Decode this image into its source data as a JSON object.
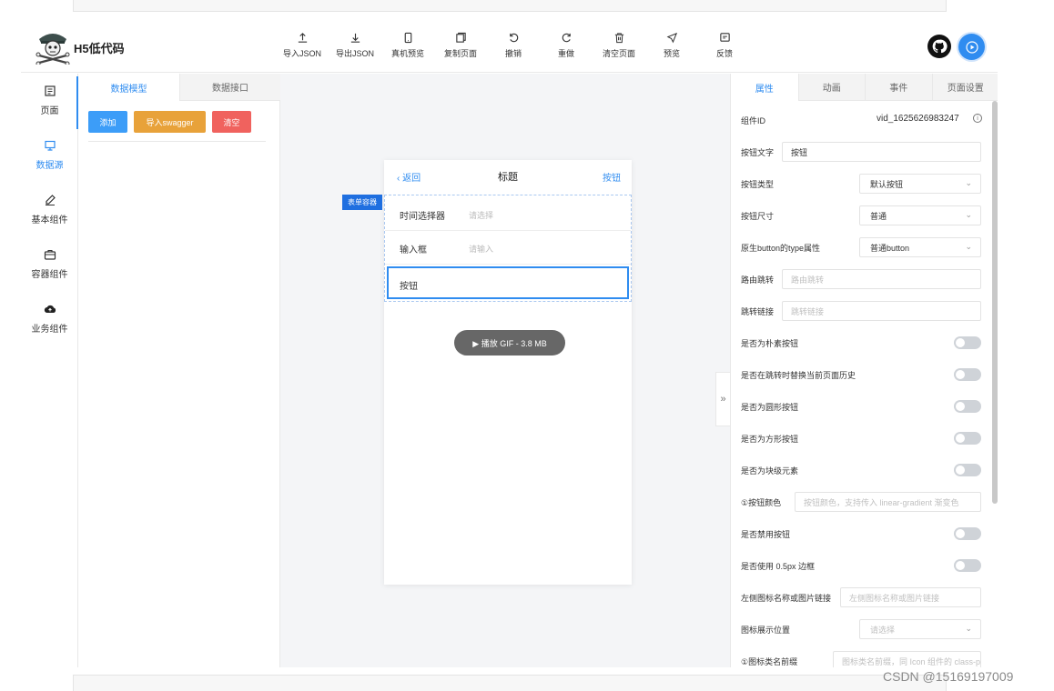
{
  "app": {
    "brand": "H5低代码",
    "toolbar": [
      {
        "label": "导入JSON",
        "icon": "upload-icon"
      },
      {
        "label": "导出JSON",
        "icon": "download-icon"
      },
      {
        "label": "真机预览",
        "icon": "phone-icon"
      },
      {
        "label": "复制页面",
        "icon": "copy-icon"
      },
      {
        "label": "撤销",
        "icon": "undo-icon"
      },
      {
        "label": "重做",
        "icon": "redo-icon"
      },
      {
        "label": "清空页面",
        "icon": "trash-icon"
      },
      {
        "label": "预览",
        "icon": "send-icon"
      },
      {
        "label": "反馈",
        "icon": "feedback-icon"
      }
    ]
  },
  "sidebar": {
    "items": [
      {
        "label": "页面",
        "icon": "page-icon"
      },
      {
        "label": "数据源",
        "icon": "monitor-icon"
      },
      {
        "label": "基本组件",
        "icon": "pen-icon"
      },
      {
        "label": "容器组件",
        "icon": "container-icon"
      },
      {
        "label": "业务组件",
        "icon": "cloud-icon"
      }
    ],
    "active": "数据源"
  },
  "data_panel": {
    "tabs": [
      "数据模型",
      "数据接口"
    ],
    "buttons": {
      "add": "添加",
      "swagger": "导入swagger",
      "clear": "清空"
    }
  },
  "canvas": {
    "nav": {
      "back": "返回",
      "title": "标题",
      "right": "按钮"
    },
    "form_tag": "表单容器",
    "fields": [
      {
        "label": "时间选择器",
        "placeholder": "请选择"
      },
      {
        "label": "输入框",
        "placeholder": "请输入"
      }
    ],
    "selected_button": "按钮",
    "gif_pill": "▶ 播放 GIF - 3.8 MB"
  },
  "props": {
    "tabs": [
      "属性",
      "动画",
      "事件",
      "页面设置"
    ],
    "component_id_label": "组件ID",
    "component_id": "vid_1625626983247",
    "button_text_label": "按钮文字",
    "button_text": "按钮",
    "button_type_label": "按钮类型",
    "button_type": "默认按钮",
    "button_size_label": "按钮尺寸",
    "button_size": "普通",
    "native_type_label": "原生button的type属性",
    "native_type": "普通button",
    "route_label": "路由跳转",
    "route_placeholder": "路由跳转",
    "link_label": "跳转链接",
    "link_placeholder": "跳转链接",
    "toggle_plain": "是否为朴素按钮",
    "toggle_replace": "是否在跳转时替换当前页面历史",
    "toggle_round": "是否为圆形按钮",
    "toggle_square": "是否为方形按钮",
    "toggle_block": "是否为块级元素",
    "color_label": "①按钮颜色",
    "color_placeholder": "按钮颜色，支持传入 linear-gradient 渐变色",
    "toggle_disabled": "是否禁用按钮",
    "toggle_hairline": "是否使用 0.5px 边框",
    "icon_label": "左侧图标名称或图片链接",
    "icon_placeholder": "左侧图标名称或图片链接",
    "icon_pos_label": "图标展示位置",
    "icon_pos_placeholder": "请选择",
    "icon_prefix_label": "①图标类名前缀",
    "icon_prefix_placeholder": "图标类名前缀，同 Icon 组件的 class-pref"
  },
  "watermark": "CSDN @15169197009"
}
